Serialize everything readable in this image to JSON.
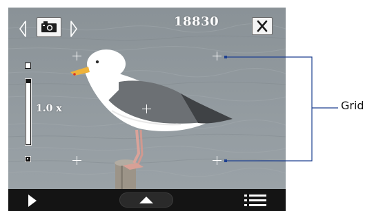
{
  "camera": {
    "counter": "18830",
    "zoom_label": "1.0 x",
    "zoom_level": 0.95,
    "grid_label": "Grid"
  },
  "icons": {
    "prev": "chevron-left-icon",
    "mode": "camera-icon",
    "next": "chevron-right-icon",
    "close": "close-icon",
    "play": "play-icon",
    "expand": "triangle-up-icon",
    "menu": "menu-list-icon"
  },
  "colors": {
    "screen_bg": "#8e969b",
    "bottom_bar": "#141414",
    "callout_line": "#1c3f8f"
  }
}
